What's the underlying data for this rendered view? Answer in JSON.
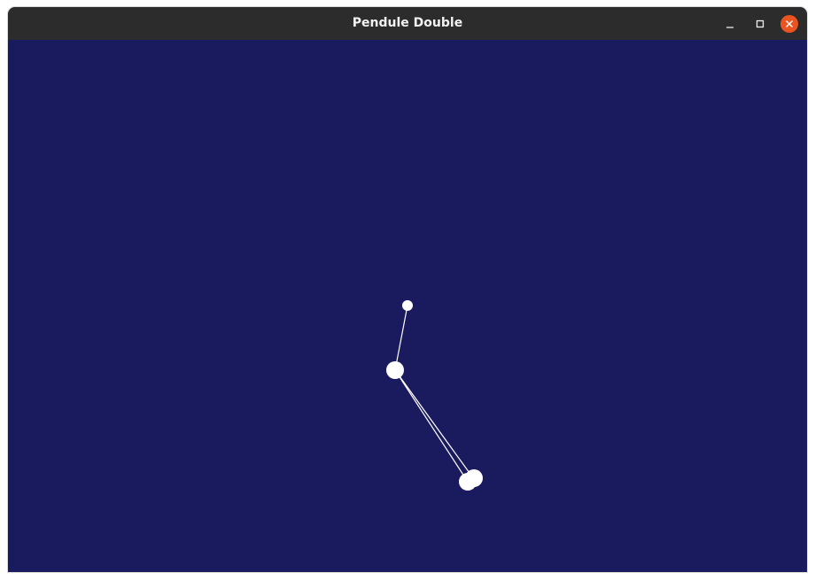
{
  "window": {
    "title": "Pendule Double",
    "background_color": "#1a1a5e",
    "titlebar_color": "#2c2c2c"
  },
  "controls": {
    "minimize_icon": "minimize-icon",
    "maximize_icon": "maximize-icon",
    "close_icon": "close-icon",
    "close_color": "#e95420"
  },
  "scene": {
    "pendulum_color": "#ffffff"
  }
}
